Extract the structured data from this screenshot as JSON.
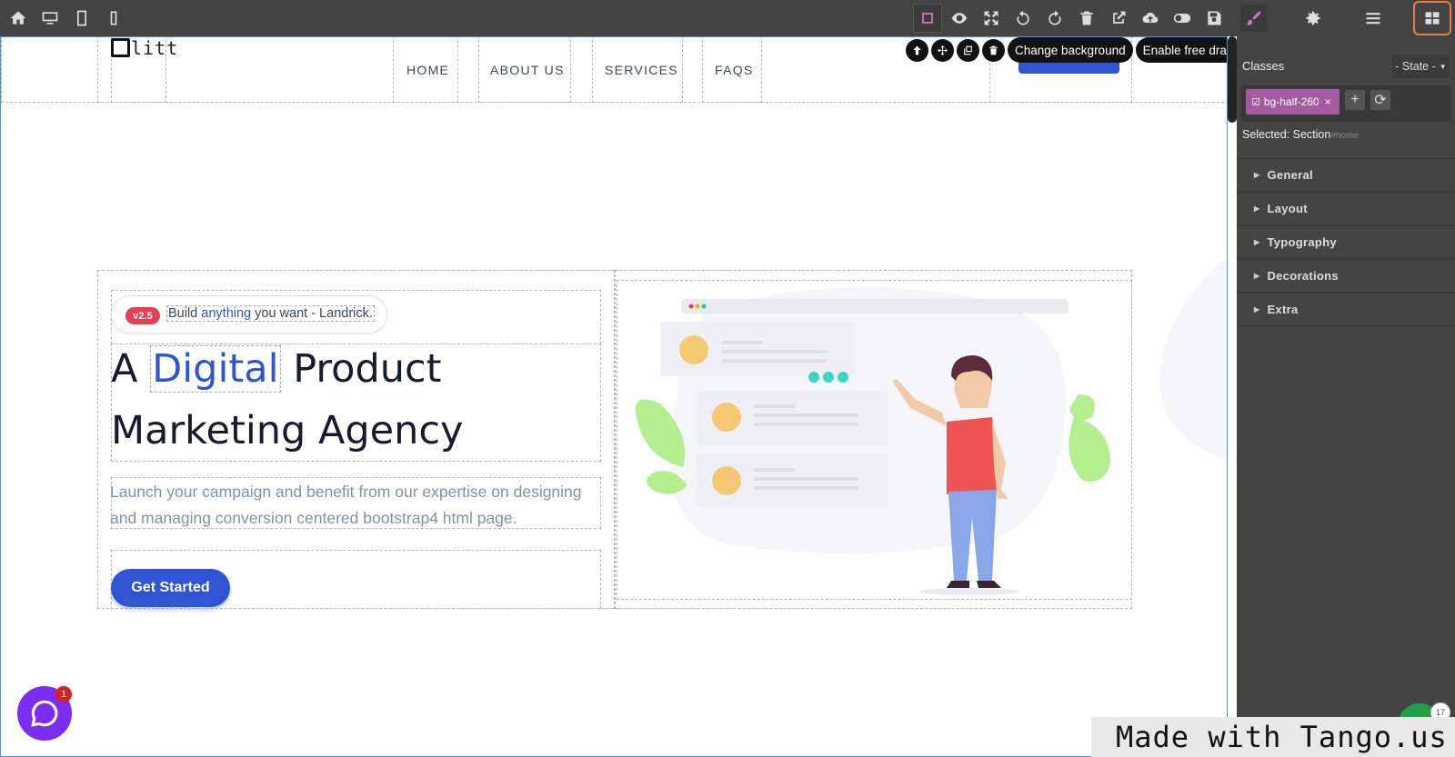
{
  "toolbar": {
    "left_icons": [
      "home-icon",
      "desktop-icon",
      "tablet-icon",
      "mobile-icon"
    ],
    "right_icons": [
      "component-outline-icon",
      "preview-eye-icon",
      "fullscreen-icon",
      "undo-icon",
      "redo-icon",
      "trash-icon",
      "export-icon",
      "cloud-upload-icon",
      "toggle-icon",
      "save-icon",
      "brush-icon",
      "gear-icon",
      "layers-icon",
      "blocks-icon"
    ]
  },
  "site": {
    "logo_text": "litt",
    "nav": [
      "HOME",
      "ABOUT US",
      "SERVICES",
      "FAQS"
    ],
    "badge": "v2.5",
    "badge_text_before": "Build ",
    "badge_text_highlight": "anything",
    "badge_text_after": " you want - Landrick.",
    "title_line1_before": "A ",
    "title_line1_highlight": "Digital",
    "title_line1_after": " Product",
    "title_line2": "Marketing Agency",
    "description": "Launch your campaign and benefit from our expertise on designing and managing conversion centered bootstrap4 html page.",
    "cta": "Get Started"
  },
  "object_tools": {
    "icons": [
      "arrow-up-icon",
      "move-icon",
      "clone-icon",
      "delete-icon"
    ],
    "change_background": "Change background",
    "free_drag": "Enable free drag"
  },
  "panel": {
    "classes_label": "Classes",
    "state_label": "- State -",
    "class_tag": "bg-half-260",
    "selected_label": "Selected:",
    "selected_value": "Section",
    "selected_id": "#home",
    "sectors": [
      "General",
      "Layout",
      "Typography",
      "Decorations",
      "Extra"
    ]
  },
  "overlays": {
    "chat_count": "1",
    "watermark": "Made with Tango.us",
    "small_count": "17"
  },
  "colors": {
    "toolbar_bg": "#444444",
    "accent_blue": "#2f55d4",
    "badge_red": "#e43f52",
    "class_tag_purple": "#a35aa1",
    "active_outline": "#e67e50"
  }
}
